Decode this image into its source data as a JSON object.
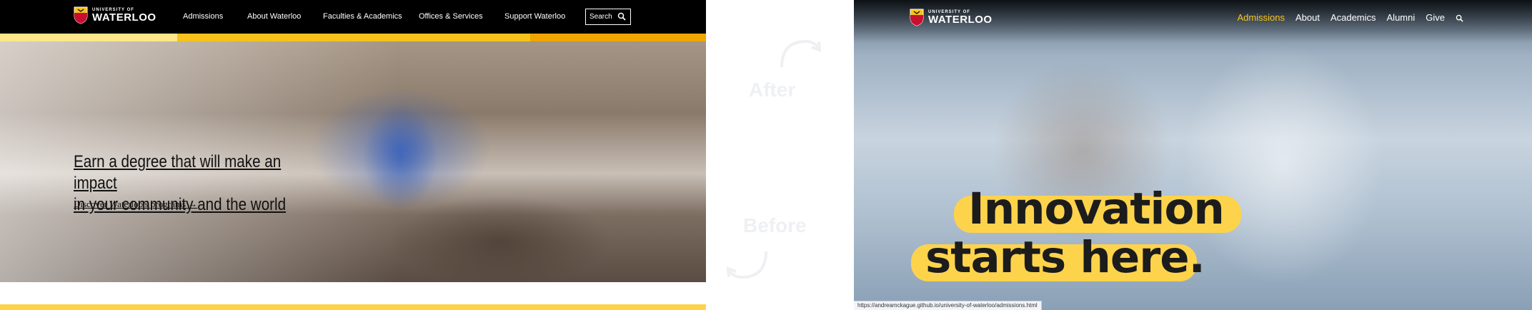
{
  "before": {
    "logo": {
      "small": "UNIVERSITY OF",
      "big": "WATERLOO"
    },
    "nav": [
      {
        "label": "Admissions"
      },
      {
        "label": "About Waterloo"
      },
      {
        "label": "Faculties & Academics"
      },
      {
        "label": "Offices & Services"
      },
      {
        "label": "Support Waterloo"
      }
    ],
    "search": {
      "label": "Search",
      "icon": "search-icon"
    },
    "hero": {
      "headline_line1": "Earn a degree that will make an impact",
      "headline_line2": "in your community and the world",
      "link": "Discover Waterloo's programs →"
    },
    "colors": {
      "gold": "#f6c21b",
      "gold_light": "#fee68a",
      "gold_dark": "#f0a500"
    }
  },
  "labels": {
    "after": "After",
    "before": "Before"
  },
  "after": {
    "logo": {
      "small": "UNIVERSITY OF",
      "big": "WATERLOO"
    },
    "nav": [
      {
        "label": "Admissions",
        "active": true
      },
      {
        "label": "About"
      },
      {
        "label": "Academics"
      },
      {
        "label": "Alumni"
      },
      {
        "label": "Give"
      }
    ],
    "search_icon": "search-icon",
    "headline_line1": "Innovation",
    "headline_line2": "starts here.",
    "status_url": "https://andreamckague.github.io/university-of-waterloo/admissions.html",
    "colors": {
      "highlight": "#fed34c",
      "active_nav": "#f8c51c"
    }
  }
}
